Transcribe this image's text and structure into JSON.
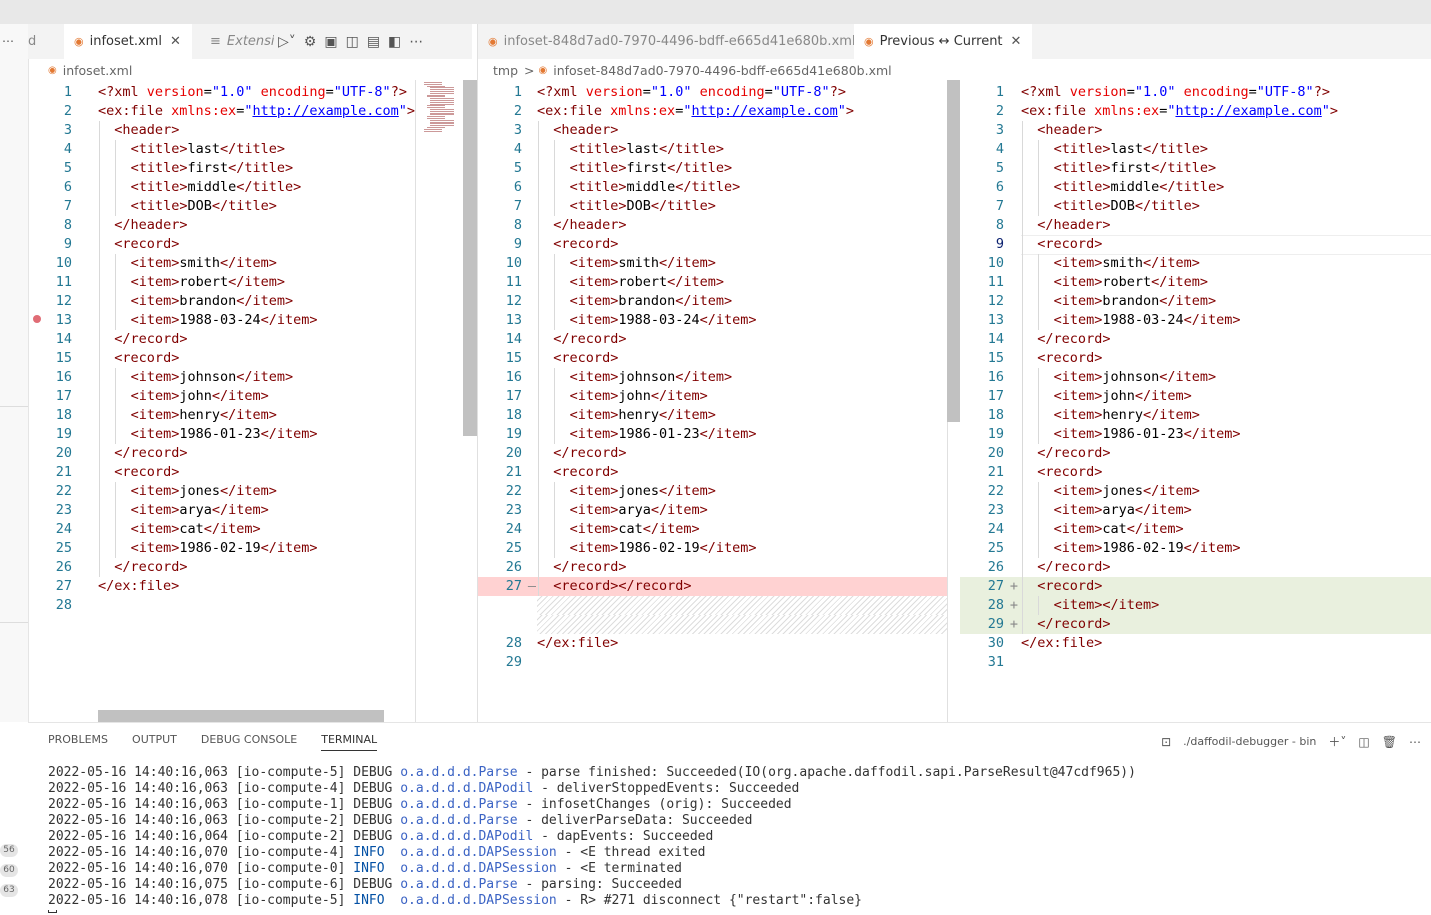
{
  "tabs": {
    "left_partial": "d",
    "infoset": "infoset.xml",
    "extension": "Extensio",
    "diff_file": "infoset-848d7ad0-7970-4496-bdff-e665d41e680b.xml",
    "compare": "Previous ↔ Current"
  },
  "breadcrumbs": {
    "left": "infoset.xml",
    "mid_folder": "tmp",
    "mid_sep": ">",
    "mid_file": "infoset-848d7ad0-7970-4496-bdff-e665d41e680b.xml"
  },
  "panel": {
    "tabs": [
      "PROBLEMS",
      "OUTPUT",
      "DEBUG CONSOLE",
      "TERMINAL"
    ],
    "active_tab": "TERMINAL",
    "terminal_name": "./daffodil-debugger - bin",
    "badges": [
      "56",
      "60",
      "63"
    ],
    "terminal_lines": [
      {
        "ts": "2022-05-16 14:40:16,063",
        "thread": "[io-compute-5]",
        "level": "DEBUG",
        "cls": "o.a.d.d.d.Parse",
        "msg": " - parse finished: Succeeded(IO(org.apache.daffodil.sapi.ParseResult@47cdf965))"
      },
      {
        "ts": "2022-05-16 14:40:16,063",
        "thread": "[io-compute-4]",
        "level": "DEBUG",
        "cls": "o.a.d.d.d.DAPodil",
        "msg": " - deliverStoppedEvents: Succeeded"
      },
      {
        "ts": "2022-05-16 14:40:16,063",
        "thread": "[io-compute-1]",
        "level": "DEBUG",
        "cls": "o.a.d.d.d.Parse",
        "msg": " - infosetChanges (orig): Succeeded"
      },
      {
        "ts": "2022-05-16 14:40:16,063",
        "thread": "[io-compute-2]",
        "level": "DEBUG",
        "cls": "o.a.d.d.d.Parse",
        "msg": " - deliverParseData: Succeeded"
      },
      {
        "ts": "2022-05-16 14:40:16,064",
        "thread": "[io-compute-2]",
        "level": "DEBUG",
        "cls": "o.a.d.d.d.DAPodil",
        "msg": " - dapEvents: Succeeded"
      },
      {
        "ts": "2022-05-16 14:40:16,070",
        "thread": "[io-compute-4]",
        "level": "INFO ",
        "cls": "o.a.d.d.d.DAPSession",
        "msg": " - <E thread exited"
      },
      {
        "ts": "2022-05-16 14:40:16,070",
        "thread": "[io-compute-0]",
        "level": "INFO ",
        "cls": "o.a.d.d.d.DAPSession",
        "msg": " - <E terminated"
      },
      {
        "ts": "2022-05-16 14:40:16,075",
        "thread": "[io-compute-6]",
        "level": "DEBUG",
        "cls": "o.a.d.d.d.Parse",
        "msg": " - parsing: Succeeded"
      },
      {
        "ts": "2022-05-16 14:40:16,078",
        "thread": "[io-compute-5]",
        "level": "INFO ",
        "cls": "o.a.d.d.d.DAPSession",
        "msg": " - R> #271 disconnect {\"restart\":false}"
      }
    ]
  },
  "editors": {
    "left": [
      {
        "n": "1",
        "i": 0,
        "t": "decl"
      },
      {
        "n": "2",
        "i": 0,
        "t": "root"
      },
      {
        "n": "3",
        "i": 1,
        "t": "open",
        "v": "header"
      },
      {
        "n": "4",
        "i": 2,
        "t": "el",
        "e": "title",
        "v": "last"
      },
      {
        "n": "5",
        "i": 2,
        "t": "el",
        "e": "title",
        "v": "first"
      },
      {
        "n": "6",
        "i": 2,
        "t": "el",
        "e": "title",
        "v": "middle"
      },
      {
        "n": "7",
        "i": 2,
        "t": "el",
        "e": "title",
        "v": "DOB"
      },
      {
        "n": "8",
        "i": 1,
        "t": "close",
        "v": "header"
      },
      {
        "n": "9",
        "i": 1,
        "t": "open",
        "v": "record"
      },
      {
        "n": "10",
        "i": 2,
        "t": "el",
        "e": "item",
        "v": "smith"
      },
      {
        "n": "11",
        "i": 2,
        "t": "el",
        "e": "item",
        "v": "robert"
      },
      {
        "n": "12",
        "i": 2,
        "t": "el",
        "e": "item",
        "v": "brandon"
      },
      {
        "n": "13",
        "i": 2,
        "t": "el",
        "e": "item",
        "v": "1988-03-24"
      },
      {
        "n": "14",
        "i": 1,
        "t": "close",
        "v": "record"
      },
      {
        "n": "15",
        "i": 1,
        "t": "open",
        "v": "record"
      },
      {
        "n": "16",
        "i": 2,
        "t": "el",
        "e": "item",
        "v": "johnson"
      },
      {
        "n": "17",
        "i": 2,
        "t": "el",
        "e": "item",
        "v": "john"
      },
      {
        "n": "18",
        "i": 2,
        "t": "el",
        "e": "item",
        "v": "henry"
      },
      {
        "n": "19",
        "i": 2,
        "t": "el",
        "e": "item",
        "v": "1986-01-23"
      },
      {
        "n": "20",
        "i": 1,
        "t": "close",
        "v": "record"
      },
      {
        "n": "21",
        "i": 1,
        "t": "open",
        "v": "record"
      },
      {
        "n": "22",
        "i": 2,
        "t": "el",
        "e": "item",
        "v": "jones"
      },
      {
        "n": "23",
        "i": 2,
        "t": "el",
        "e": "item",
        "v": "arya"
      },
      {
        "n": "24",
        "i": 2,
        "t": "el",
        "e": "item",
        "v": "cat"
      },
      {
        "n": "25",
        "i": 2,
        "t": "el",
        "e": "item",
        "v": "1986-02-19"
      },
      {
        "n": "26",
        "i": 1,
        "t": "close",
        "v": "record"
      },
      {
        "n": "27",
        "i": 0,
        "t": "close",
        "v": "ex:file"
      },
      {
        "n": "28",
        "i": 0,
        "t": "blank"
      }
    ],
    "mid": [
      {
        "n": "1",
        "i": 0,
        "t": "decl"
      },
      {
        "n": "2",
        "i": 0,
        "t": "root"
      },
      {
        "n": "3",
        "i": 1,
        "t": "open",
        "v": "header"
      },
      {
        "n": "4",
        "i": 2,
        "t": "el",
        "e": "title",
        "v": "last"
      },
      {
        "n": "5",
        "i": 2,
        "t": "el",
        "e": "title",
        "v": "first"
      },
      {
        "n": "6",
        "i": 2,
        "t": "el",
        "e": "title",
        "v": "middle"
      },
      {
        "n": "7",
        "i": 2,
        "t": "el",
        "e": "title",
        "v": "DOB"
      },
      {
        "n": "8",
        "i": 1,
        "t": "close",
        "v": "header"
      },
      {
        "n": "9",
        "i": 1,
        "t": "open",
        "v": "record"
      },
      {
        "n": "10",
        "i": 2,
        "t": "el",
        "e": "item",
        "v": "smith"
      },
      {
        "n": "11",
        "i": 2,
        "t": "el",
        "e": "item",
        "v": "robert"
      },
      {
        "n": "12",
        "i": 2,
        "t": "el",
        "e": "item",
        "v": "brandon"
      },
      {
        "n": "13",
        "i": 2,
        "t": "el",
        "e": "item",
        "v": "1988-03-24"
      },
      {
        "n": "14",
        "i": 1,
        "t": "close",
        "v": "record"
      },
      {
        "n": "15",
        "i": 1,
        "t": "open",
        "v": "record"
      },
      {
        "n": "16",
        "i": 2,
        "t": "el",
        "e": "item",
        "v": "johnson"
      },
      {
        "n": "17",
        "i": 2,
        "t": "el",
        "e": "item",
        "v": "john"
      },
      {
        "n": "18",
        "i": 2,
        "t": "el",
        "e": "item",
        "v": "henry"
      },
      {
        "n": "19",
        "i": 2,
        "t": "el",
        "e": "item",
        "v": "1986-01-23"
      },
      {
        "n": "20",
        "i": 1,
        "t": "close",
        "v": "record"
      },
      {
        "n": "21",
        "i": 1,
        "t": "open",
        "v": "record"
      },
      {
        "n": "22",
        "i": 2,
        "t": "el",
        "e": "item",
        "v": "jones"
      },
      {
        "n": "23",
        "i": 2,
        "t": "el",
        "e": "item",
        "v": "arya"
      },
      {
        "n": "24",
        "i": 2,
        "t": "el",
        "e": "item",
        "v": "cat"
      },
      {
        "n": "25",
        "i": 2,
        "t": "el",
        "e": "item",
        "v": "1986-02-19"
      },
      {
        "n": "26",
        "i": 1,
        "t": "close",
        "v": "record"
      },
      {
        "n": "27",
        "i": 1,
        "t": "empty",
        "v": "record",
        "mark": "—",
        "diff": "removed"
      },
      {
        "n": "",
        "i": 0,
        "t": "hatch"
      },
      {
        "n": "",
        "i": 0,
        "t": "hatch"
      },
      {
        "n": "28",
        "i": 0,
        "t": "close",
        "v": "ex:file"
      },
      {
        "n": "29",
        "i": 0,
        "t": "blank"
      }
    ],
    "right": [
      {
        "n": "1",
        "i": 0,
        "t": "decl"
      },
      {
        "n": "2",
        "i": 0,
        "t": "root"
      },
      {
        "n": "3",
        "i": 1,
        "t": "open",
        "v": "header"
      },
      {
        "n": "4",
        "i": 2,
        "t": "el",
        "e": "title",
        "v": "last"
      },
      {
        "n": "5",
        "i": 2,
        "t": "el",
        "e": "title",
        "v": "first"
      },
      {
        "n": "6",
        "i": 2,
        "t": "el",
        "e": "title",
        "v": "middle"
      },
      {
        "n": "7",
        "i": 2,
        "t": "el",
        "e": "title",
        "v": "DOB"
      },
      {
        "n": "8",
        "i": 1,
        "t": "close",
        "v": "header"
      },
      {
        "n": "9",
        "i": 1,
        "t": "open",
        "v": "record",
        "cur": true
      },
      {
        "n": "10",
        "i": 2,
        "t": "el",
        "e": "item",
        "v": "smith"
      },
      {
        "n": "11",
        "i": 2,
        "t": "el",
        "e": "item",
        "v": "robert"
      },
      {
        "n": "12",
        "i": 2,
        "t": "el",
        "e": "item",
        "v": "brandon"
      },
      {
        "n": "13",
        "i": 2,
        "t": "el",
        "e": "item",
        "v": "1988-03-24"
      },
      {
        "n": "14",
        "i": 1,
        "t": "close",
        "v": "record"
      },
      {
        "n": "15",
        "i": 1,
        "t": "open",
        "v": "record"
      },
      {
        "n": "16",
        "i": 2,
        "t": "el",
        "e": "item",
        "v": "johnson"
      },
      {
        "n": "17",
        "i": 2,
        "t": "el",
        "e": "item",
        "v": "john"
      },
      {
        "n": "18",
        "i": 2,
        "t": "el",
        "e": "item",
        "v": "henry"
      },
      {
        "n": "19",
        "i": 2,
        "t": "el",
        "e": "item",
        "v": "1986-01-23"
      },
      {
        "n": "20",
        "i": 1,
        "t": "close",
        "v": "record"
      },
      {
        "n": "21",
        "i": 1,
        "t": "open",
        "v": "record"
      },
      {
        "n": "22",
        "i": 2,
        "t": "el",
        "e": "item",
        "v": "jones"
      },
      {
        "n": "23",
        "i": 2,
        "t": "el",
        "e": "item",
        "v": "arya"
      },
      {
        "n": "24",
        "i": 2,
        "t": "el",
        "e": "item",
        "v": "cat"
      },
      {
        "n": "25",
        "i": 2,
        "t": "el",
        "e": "item",
        "v": "1986-02-19"
      },
      {
        "n": "26",
        "i": 1,
        "t": "close",
        "v": "record"
      },
      {
        "n": "27",
        "i": 1,
        "t": "open",
        "v": "record",
        "mark": "+",
        "diff": "added"
      },
      {
        "n": "28",
        "i": 2,
        "t": "empty",
        "v": "item",
        "mark": "+",
        "diff": "added"
      },
      {
        "n": "29",
        "i": 1,
        "t": "close",
        "v": "record",
        "mark": "+",
        "diff": "added"
      },
      {
        "n": "30",
        "i": 0,
        "t": "close",
        "v": "ex:file"
      },
      {
        "n": "31",
        "i": 0,
        "t": "blank"
      }
    ],
    "xml": {
      "decl_tag": "<?xml",
      "version_attr": "version",
      "version_val": "\"1.0\"",
      "enc_attr": "encoding",
      "enc_val": "\"UTF-8\"",
      "root_tag": "<ex:file",
      "ns_attr": "xmlns:ex",
      "ns_val": "http://example.com"
    }
  }
}
